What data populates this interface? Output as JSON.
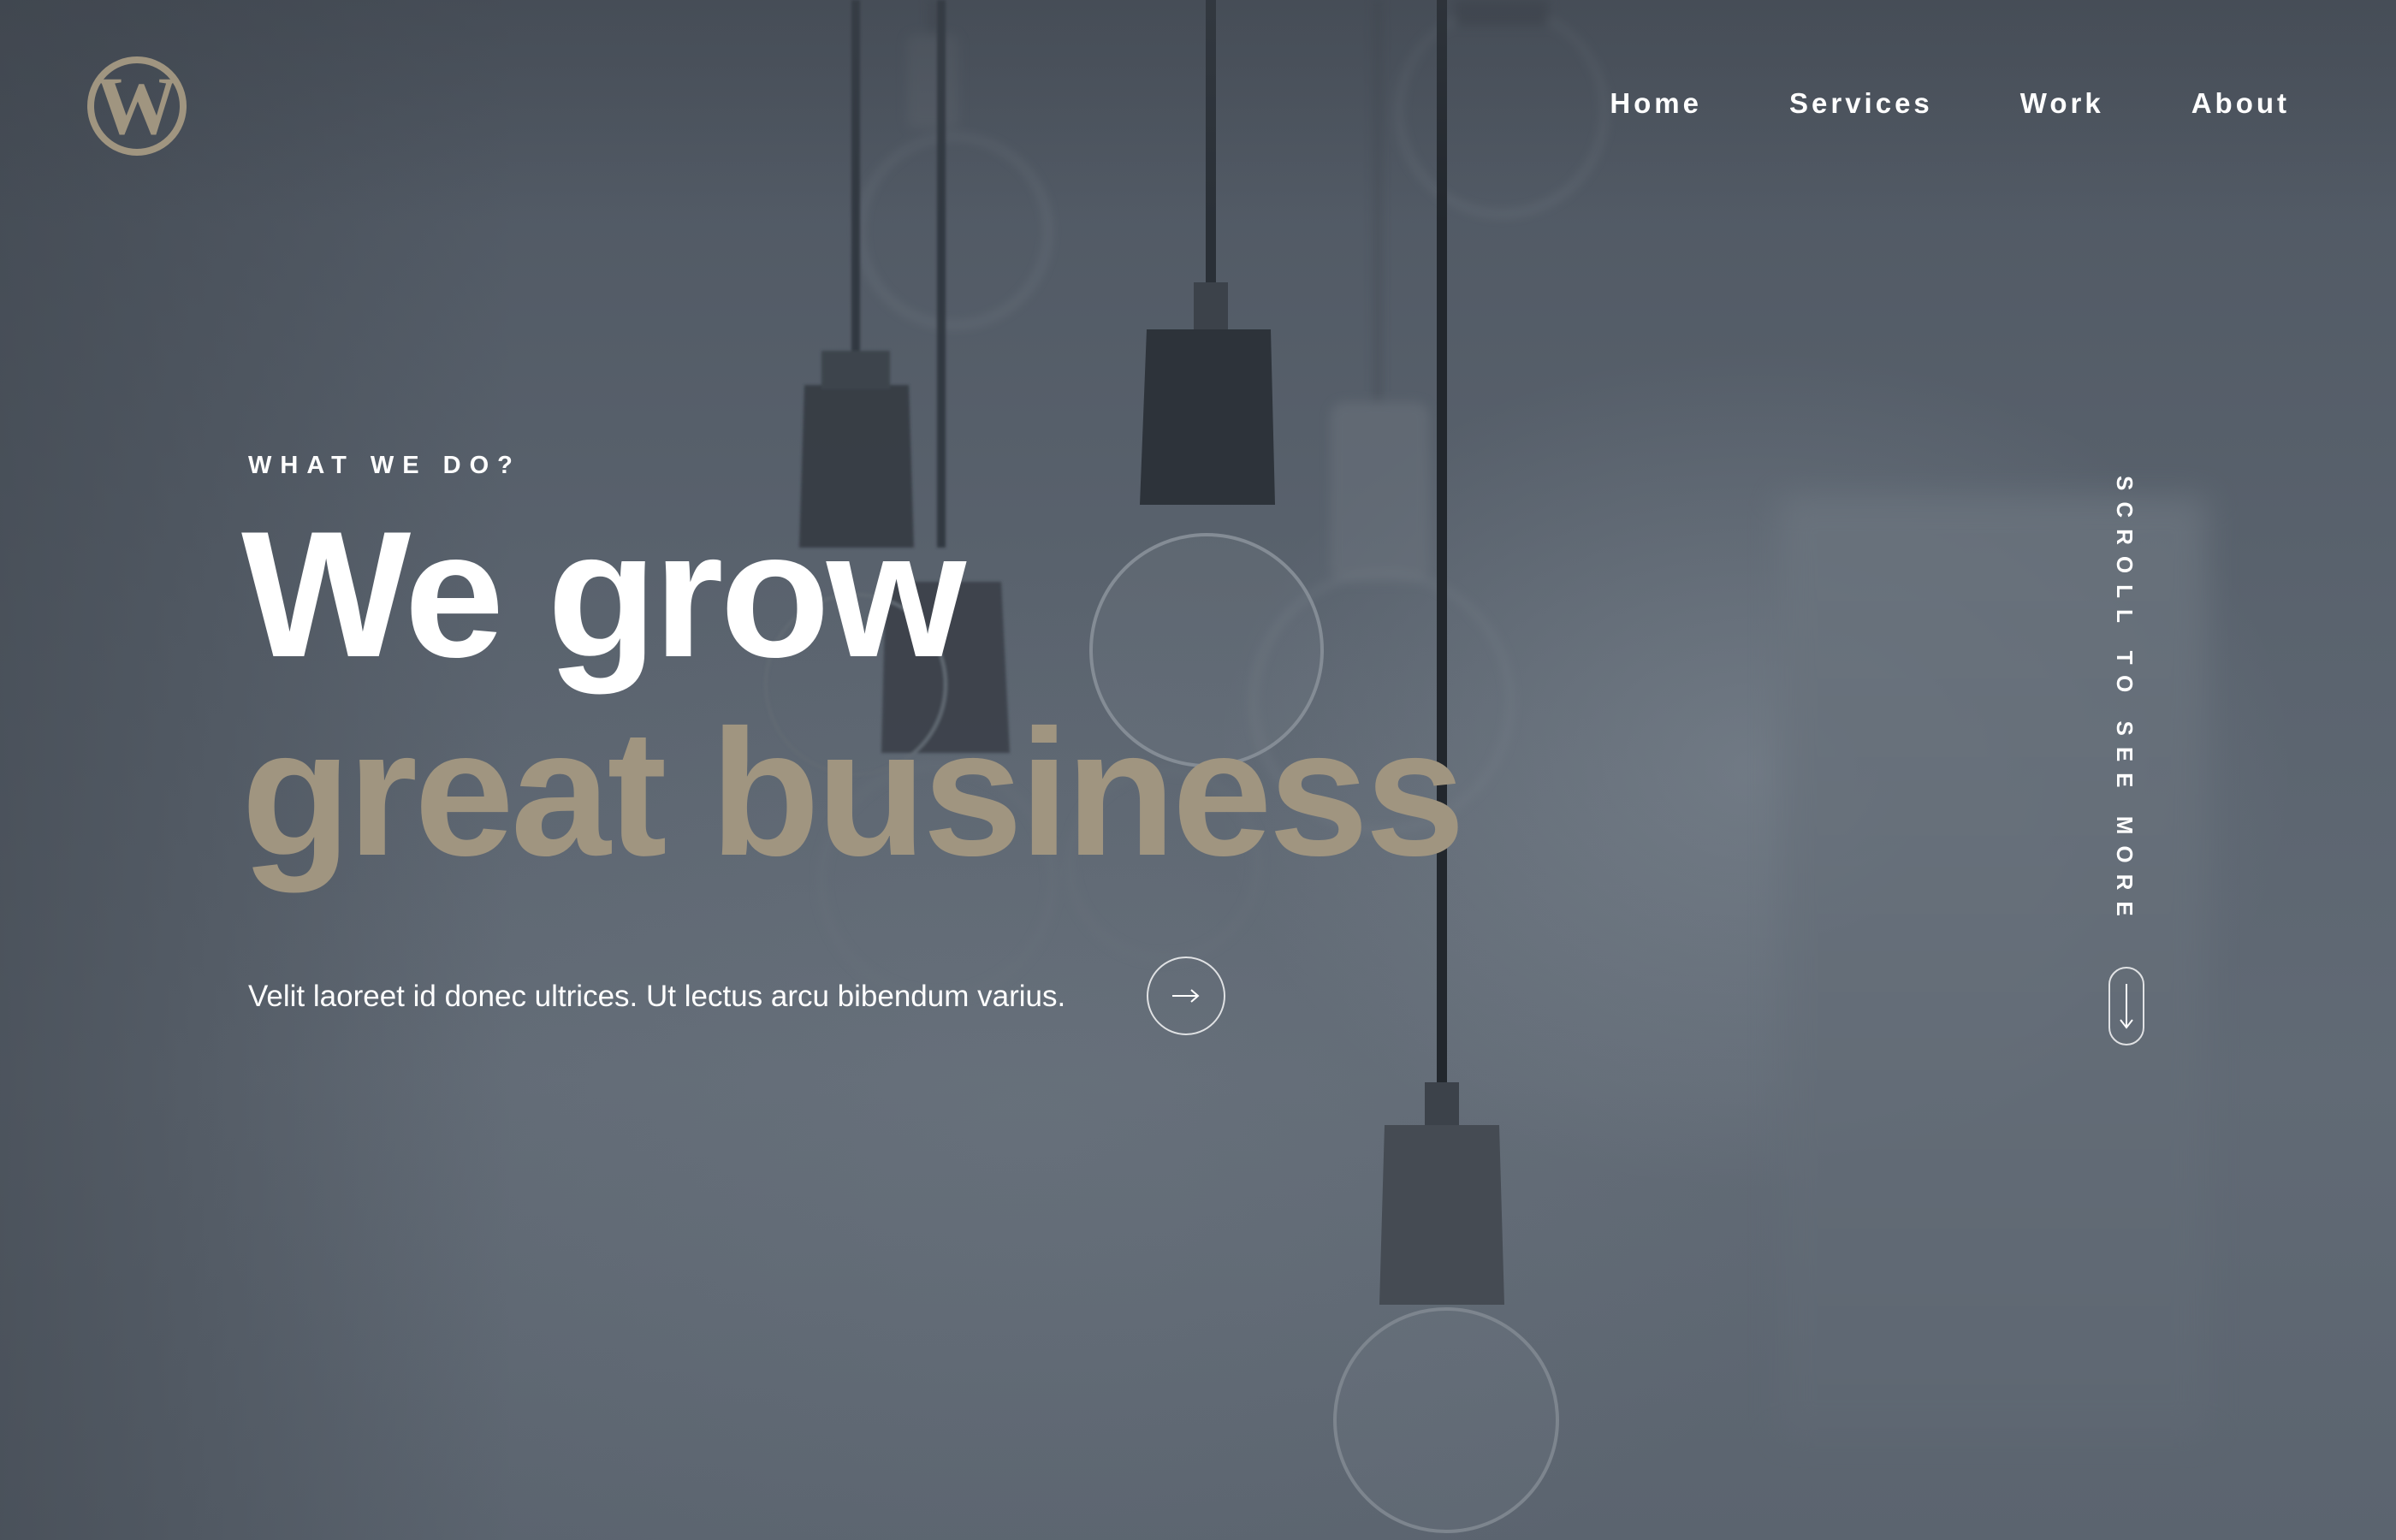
{
  "brand": {
    "logo_icon": "wordpress-logo-icon",
    "accent_color": "#a09580"
  },
  "nav": {
    "items": [
      {
        "label": "Home"
      },
      {
        "label": "Services"
      },
      {
        "label": "Work"
      },
      {
        "label": "About"
      }
    ]
  },
  "hero": {
    "eyebrow": "WHAT WE DO?",
    "headline_line1": "We grow",
    "headline_line2": "great business",
    "lead": "Velit laoreet id donec ultrices. Ut lectus arcu bibendum varius.",
    "cta_icon": "arrow-right-icon"
  },
  "scroll_hint": {
    "label": "SCROLL TO SEE MORE",
    "icon": "arrow-down-icon"
  },
  "background": {
    "image": "hanging-light-bulbs-photo",
    "overlay_color": "#525b66"
  }
}
